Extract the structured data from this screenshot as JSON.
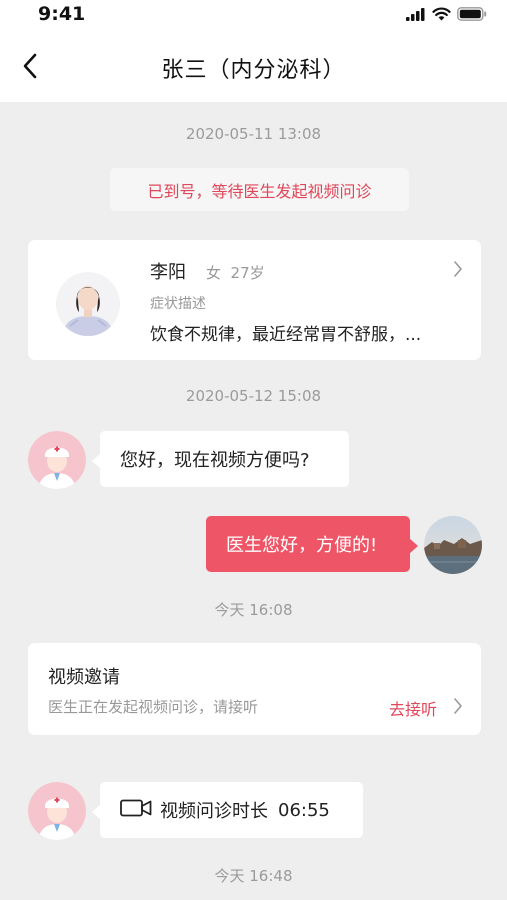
{
  "status": {
    "time": "9:41"
  },
  "nav": {
    "title": "张三（内分泌科）"
  },
  "messages": {
    "ts1": "2020-05-11 13:08",
    "notice": "已到号，等待医生发起视频问诊",
    "patient": {
      "name": "李阳",
      "meta": "女  27岁",
      "symptom_label": "症状描述",
      "symptom_text": "饮食不规律，最近经常胃不舒服，..."
    },
    "ts2": "2020-05-12 15:08",
    "doctor_msg": "您好，现在视频方便吗?",
    "self_msg": "医生您好，方便的!",
    "ts3": "今天 16:08",
    "invite": {
      "title": "视频邀请",
      "desc": "医生正在发起视频问诊，请接听",
      "action": "去接听"
    },
    "video_call": {
      "label": "视频问诊时长",
      "duration": "06:55"
    },
    "ts4": "今天 16:48"
  },
  "colors": {
    "accent": "#ee5668",
    "accent_text": "#e0475a",
    "background": "#eeeeee"
  },
  "icons": {
    "back": "chevron-left-icon",
    "chevron": "chevron-right-icon",
    "video": "video-camera-icon",
    "signal": "signal-icon",
    "wifi": "wifi-icon",
    "battery": "battery-icon"
  }
}
